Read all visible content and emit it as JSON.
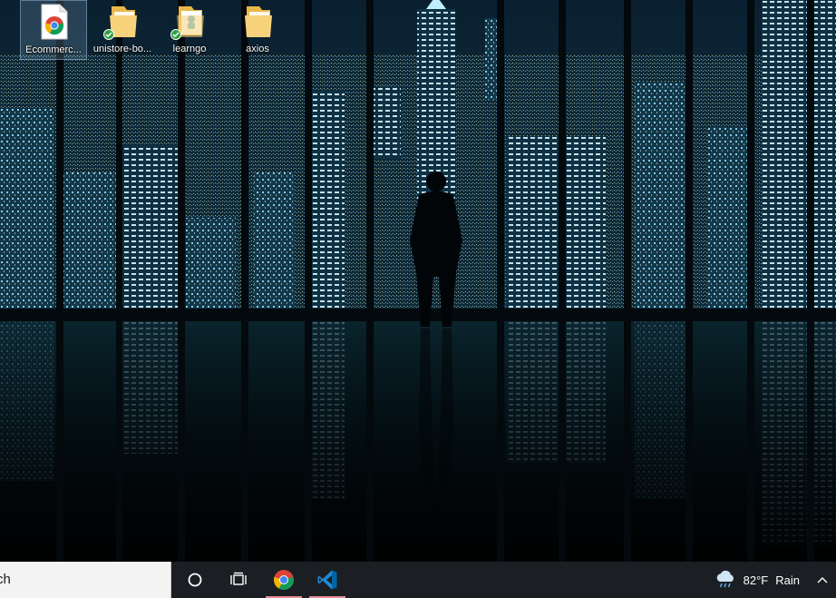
{
  "desktop": {
    "icons": [
      {
        "label": "Ecommerc...",
        "icon": "chrome-shortcut-icon",
        "selected": true
      },
      {
        "label": "unistore-bo...",
        "icon": "folder-icon",
        "status": "synced"
      },
      {
        "label": "learngo",
        "icon": "folder-icon",
        "status": "synced"
      },
      {
        "label": "axios",
        "icon": "folder-icon"
      }
    ]
  },
  "taskbar": {
    "search_text": "ch",
    "buttons": [
      "cortana-icon",
      "task-view-icon",
      "chrome-icon",
      "vscode-icon"
    ],
    "weather": {
      "temp": "82°F",
      "condition": "Rain",
      "icon": "rain-cloud-icon"
    },
    "chevron": "show-hidden-icons"
  },
  "colors": {
    "taskbar_bg": "#1b1f23",
    "search_bg": "#f3f3f3",
    "running_indicator": "#e98c96",
    "wallpaper_sky": "#0a1e2b",
    "wallpaper_glow": "#4fb3d9"
  }
}
